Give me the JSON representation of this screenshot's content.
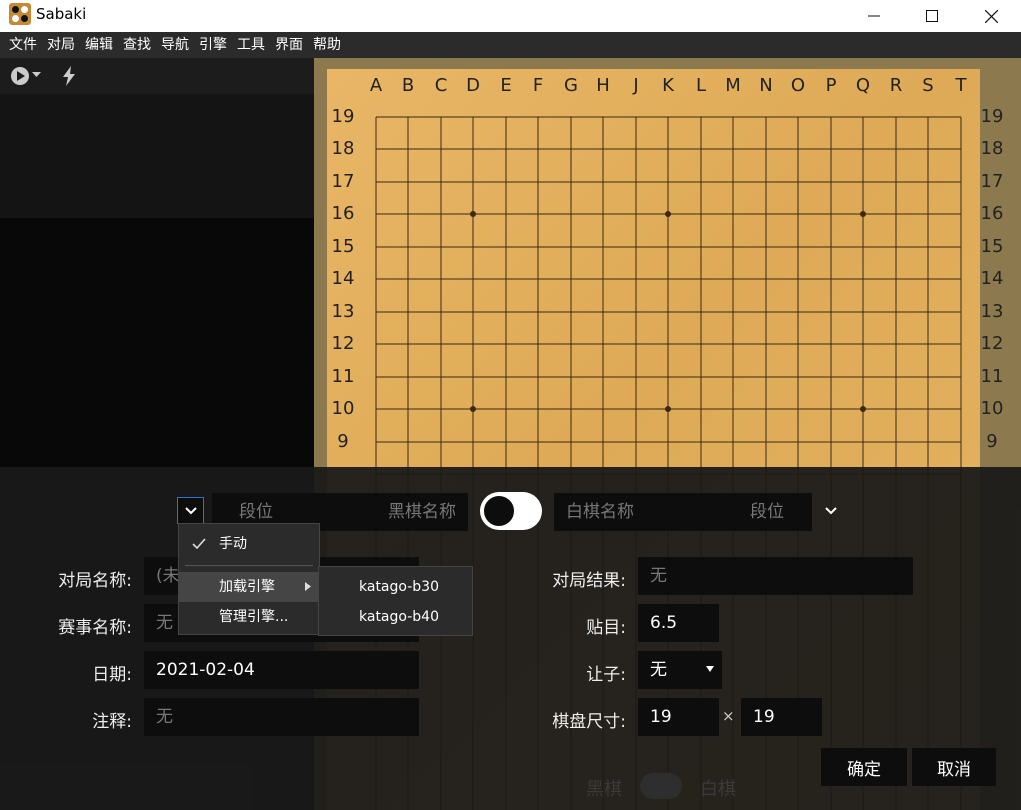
{
  "window": {
    "title": "Sabaki",
    "minimize_icon": "minimize-icon",
    "maximize_icon": "maximize-icon",
    "close_icon": "close-icon"
  },
  "menu": [
    "文件",
    "对局",
    "编辑",
    "查找",
    "导航",
    "引擎",
    "工具",
    "界面",
    "帮助"
  ],
  "toolbar": {
    "play_icon": "play-icon",
    "flash_icon": "lightning-icon"
  },
  "board": {
    "columns": [
      "A",
      "B",
      "C",
      "D",
      "E",
      "F",
      "G",
      "H",
      "J",
      "K",
      "L",
      "M",
      "N",
      "O",
      "P",
      "Q",
      "R",
      "S",
      "T"
    ],
    "rows": [
      "19",
      "18",
      "17",
      "16",
      "15",
      "14",
      "13",
      "12",
      "11",
      "10",
      "9"
    ]
  },
  "players": {
    "black_rank_placeholder": "段位",
    "black_name_placeholder": "黑棋名称",
    "white_name_placeholder": "白棋名称",
    "white_rank_placeholder": "段位"
  },
  "engine_menu": {
    "manual": "手动",
    "load_engine": "加载引擎",
    "manage_engines": "管理引擎...",
    "engines": [
      "katago-b30",
      "katago-b40"
    ]
  },
  "form": {
    "game_name_label": "对局名称:",
    "game_name_placeholder": "(未",
    "event_label": "赛事名称:",
    "event_placeholder": "无",
    "date_label": "日期:",
    "date_value": "2021-02-04",
    "comment_label": "注释:",
    "comment_placeholder": "无",
    "result_label": "对局结果:",
    "result_placeholder": "无",
    "komi_label": "贴目:",
    "komi_value": "6.5",
    "handicap_label": "让子:",
    "handicap_value": "无",
    "size_label": "棋盘尺寸:",
    "size_width": "19",
    "size_times": "×",
    "size_height": "19"
  },
  "buttons": {
    "ok": "确定",
    "cancel": "取消"
  },
  "hidden_bottom": {
    "black": "黑棋",
    "white": "白棋"
  }
}
